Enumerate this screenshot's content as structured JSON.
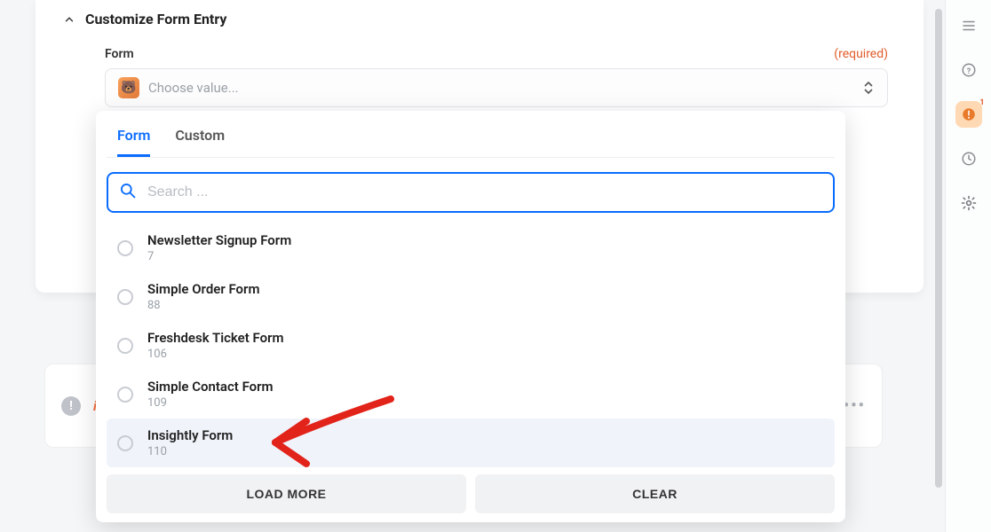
{
  "section": {
    "title": "Customize Form Entry"
  },
  "field": {
    "label": "Form",
    "required_label": "(required)",
    "placeholder": "Choose value..."
  },
  "dropdown": {
    "tabs": {
      "form": "Form",
      "custom": "Custom"
    },
    "search_placeholder": "Search ...",
    "options": [
      {
        "name": "Newsletter Signup Form",
        "id": "7"
      },
      {
        "name": "Simple Order Form",
        "id": "88"
      },
      {
        "name": "Freshdesk Ticket Form",
        "id": "106"
      },
      {
        "name": "Simple Contact Form",
        "id": "109"
      },
      {
        "name": "Insightly Form",
        "id": "110"
      }
    ],
    "highlighted_index": 4,
    "buttons": {
      "load_more": "LOAD MORE",
      "clear": "CLEAR"
    }
  },
  "bg_card": {
    "logo_text": "insig"
  },
  "rail": {
    "alert_badge": "1"
  },
  "colors": {
    "accent_blue": "#0a6cff",
    "required_orange": "#e25c2b",
    "alert_orange": "#e87a2a"
  }
}
